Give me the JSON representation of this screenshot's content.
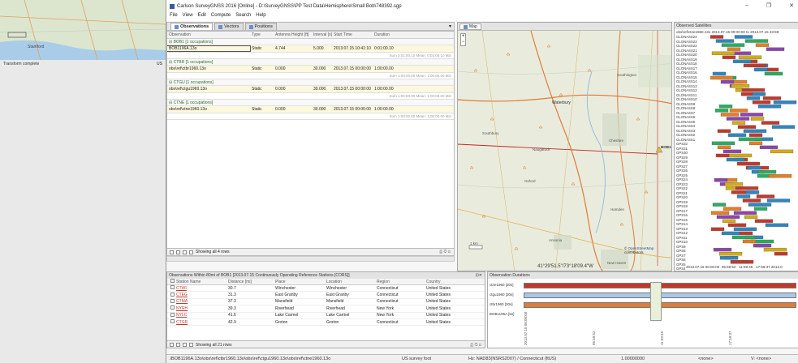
{
  "left_panel": {
    "status": "Transform complete",
    "truncated_text": "US",
    "map_places": [
      "Stamford"
    ]
  },
  "window": {
    "title": "Carlson SurveyGNSS 2016  [Online] - D:\\SurveyGNSS\\PP Test Data\\Hemisphere\\Small Bob\\748392.sgp",
    "min": "–",
    "max": "❐",
    "close": "✕"
  },
  "menu": [
    "File",
    "View",
    "Edit",
    "Compute",
    "Search",
    "Help"
  ],
  "tabs": [
    {
      "label": "Observations"
    },
    {
      "label": "Vectors"
    },
    {
      "label": "Positions"
    }
  ],
  "observations": {
    "headers": [
      "Observation",
      "Type",
      "Antenna Height [ft]",
      "Interval [s]",
      "Start Time",
      "Duration"
    ],
    "groups": [
      {
        "name": "BOB1 [1 occupations]",
        "row": [
          "BOB1196A.13o",
          "Static",
          "4.744",
          "5.000",
          "2013.07.15 10:41:10",
          "0:01:00.10"
        ],
        "summary": "Sum 0:01:00.10 Mean: 0:01:00.10 Min"
      },
      {
        "name": "CTBR [1 occupations]",
        "row": [
          "obs\\ref\\ctbr1960.13o",
          "Static",
          "0.000",
          "30.000",
          "2013.07.15 00:00:00",
          "1:00:00.00"
        ],
        "summary": "Sum 1:00:00.00 Mean: 1:00:00.00 Min"
      },
      {
        "name": "CTGU [1 occupations]",
        "row": [
          "obs\\ref\\ctgu1960.13o",
          "Static",
          "0.000",
          "30.000",
          "2013.07.15 00:00:00",
          "1:00:00.00"
        ],
        "summary": "Sum 1:00:00.00 Mean: 1:00:00.00 Min"
      },
      {
        "name": "CTNE [1 occupations]",
        "row": [
          "obs\\ref\\ctne1960.13o",
          "Static",
          "0.000",
          "30.000",
          "2013.07.15 00:00:00",
          "1:00:00.00"
        ],
        "summary": "Sum 1:00:00.00 Mean: 1:00:00.00 Min"
      }
    ],
    "footer": "Showing all 4 rows"
  },
  "map": {
    "tab": "Map",
    "zoom_in": "+",
    "zoom_out": "−",
    "places": [
      "Waterbury",
      "Southington",
      "Cheshire",
      "Naugatuck",
      "Southbury",
      "Oxford",
      "Hamden",
      "Ansonia",
      "New Haven",
      "BOB1"
    ],
    "coords": "41°29'51.5\"/73°18'09.4\"W",
    "attribution_prefix": "© ",
    "attribution_link": "OpenStreetMap",
    "attribution_suffix": " contributors",
    "scale": "1 km"
  },
  "satellites": {
    "title": "Observed Satellites",
    "subtitle": "obs\\ref\\ctne1960.13o 2013.07.15 00:00:00 to 2013.07.15 23:59:",
    "names": [
      "GLONASS24",
      "GLONASS23",
      "GLONASS22",
      "GLONASS21",
      "GLONASS20",
      "GLONASS19",
      "GLONASS18",
      "GLONASS17",
      "GLONASS16",
      "GLONASS15",
      "GLONASS14",
      "GLONASS13",
      "GLONASS12",
      "GLONASS11",
      "GLONASS10",
      "GLONASS9",
      "GLONASS8",
      "GLONASS7",
      "GLONASS6",
      "GLONASS5",
      "GLONASS4",
      "GLONASS3",
      "GLONASS2",
      "GLONASS1",
      "GPS32",
      "GPS31",
      "GPS30",
      "GPS29",
      "GPS28",
      "GPS27",
      "GPS26",
      "GPS25",
      "GPS24",
      "GPS23",
      "GPS22",
      "GPS21",
      "GPS20",
      "GPS19",
      "GPS18",
      "GPS17",
      "GPS16",
      "GPS15",
      "GPS14",
      "GPS13",
      "GPS12",
      "GPS11",
      "GPS10",
      "GPS9",
      "GPS8",
      "GPS7",
      "GPS6",
      "GPS5",
      "GPS4",
      "GPS3",
      "GPS2",
      "GPS1"
    ],
    "time_labels": [
      "2013.07.15 00:00:00",
      "05:59:52",
      "11:59:45",
      "17:59:37",
      "2013.0"
    ],
    "colors": [
      "#c0392b",
      "#2e86c1",
      "#27ae60",
      "#e67e22",
      "#8e44ad",
      "#d4ac0d",
      "#c0392b",
      "#2e86c1"
    ]
  },
  "cors": {
    "title": "Observations Within 80mi of BOB1 [2013.07.15 Continuously Operating Reference Stations [CORS]]",
    "headers": [
      "Station Name",
      "Distance [mi]",
      "Place",
      "Location",
      "Region",
      "Country"
    ],
    "rows": [
      [
        "CTWI",
        "30.7",
        "Winchester",
        "Winchester",
        "Connecticut",
        "United States"
      ],
      [
        "CTEG",
        "31.3",
        "East Granby",
        "East Granby",
        "Connecticut",
        "United States"
      ],
      [
        "CTMA",
        "37.3",
        "Mansfield",
        "Mansfield",
        "Connecticut",
        "United States"
      ],
      [
        "NYRH",
        "39.3",
        "Riverhead",
        "Riverhead",
        "New York",
        "United States"
      ],
      [
        "NYLC",
        "41.6",
        "Lake Carmel",
        "Lake Carmel",
        "New York",
        "United States"
      ],
      [
        "CTGR",
        "42.9",
        "Groton",
        "Groton",
        "Connecticut",
        "United States"
      ]
    ],
    "footer": "Showing all 21 rows"
  },
  "durations": {
    "title": "Observation Durations",
    "rows": [
      {
        "label": "ctne1960 [30s]",
        "color": "#c0392b"
      },
      {
        "label": "ctgu1960 [30s]",
        "color": "#a9c8e8"
      },
      {
        "label": "ctbr1960 [30s]",
        "color": "#e07b39"
      },
      {
        "label": "BOB1196A [5s]",
        "color": "#7d3c98"
      }
    ],
    "ticks": [
      "2013.07.15 00:00:00",
      "05:59:52",
      "11:59:45",
      "17:59:37"
    ]
  },
  "status": {
    "path": ".\\BOB1196A.13o\\obs\\ref\\ctbr1960.13o\\obs\\ref\\ctgu1960.13o\\obs\\ref\\ctne1960.13o",
    "units": "US survey foot",
    "hz": "Hz: NAD83(NSRS2007) / Connecticut (ftUS)",
    "scale": "1.00000000",
    "none": "<none>",
    "v": "V: <none>"
  }
}
